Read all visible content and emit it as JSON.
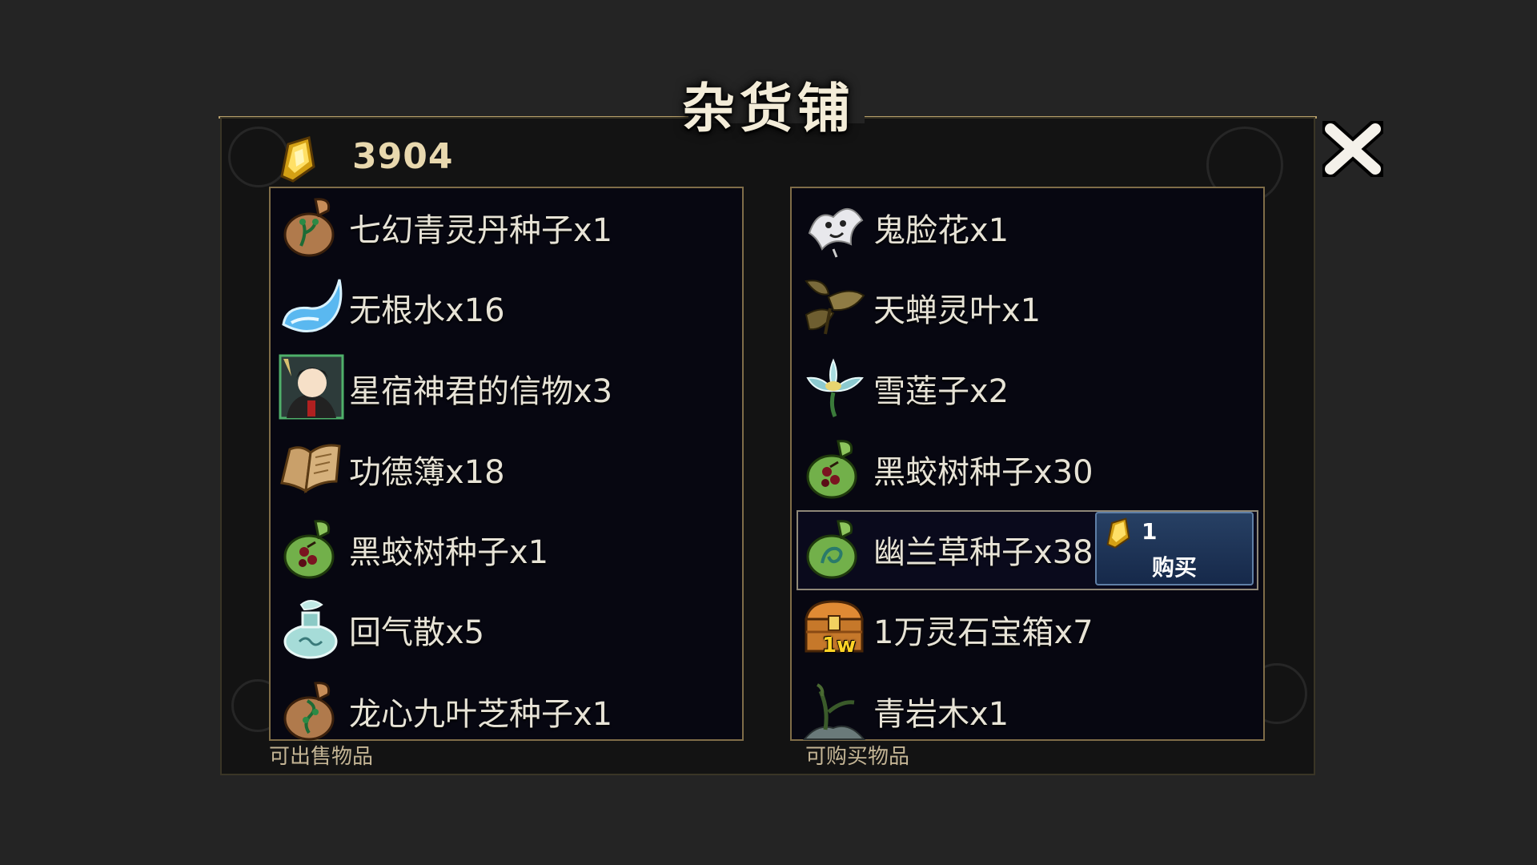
{
  "shop": {
    "title": "杂货铺",
    "currency": {
      "icon": "spirit-stone-icon",
      "amount": "3904"
    },
    "close_icon": "close-icon"
  },
  "sell_list": {
    "caption": "可出售物品",
    "items": [
      {
        "name": "七幻青灵丹种子x1",
        "icon": "brown-seed-bag-icon"
      },
      {
        "name": "无根水x16",
        "icon": "water-wisp-icon"
      },
      {
        "name": "星宿神君的信物x3",
        "icon": "deity-portrait-icon"
      },
      {
        "name": "功德簿x18",
        "icon": "open-book-icon"
      },
      {
        "name": "黑蛟树种子x1",
        "icon": "green-seed-bag-icon"
      },
      {
        "name": "回气散x5",
        "icon": "potion-jar-icon"
      },
      {
        "name": "龙心九叶芝种子x1",
        "icon": "brown-seed-bag-icon"
      }
    ]
  },
  "buy_list": {
    "caption": "可购买物品",
    "items": [
      {
        "name": "鬼脸花x1",
        "icon": "ghost-flower-icon"
      },
      {
        "name": "天蝉灵叶x1",
        "icon": "cicada-leaf-icon"
      },
      {
        "name": "雪莲子x2",
        "icon": "snow-lotus-icon"
      },
      {
        "name": "黑蛟树种子x30",
        "icon": "green-seed-bag-icon"
      },
      {
        "name": "幽兰草种子x38",
        "icon": "green-seed-bag-icon",
        "selected": true
      },
      {
        "name": "1万灵石宝箱x7",
        "icon": "treasure-chest-icon",
        "badge": "1w"
      },
      {
        "name": "青岩木x1",
        "icon": "sapling-rock-icon"
      }
    ],
    "buy_button": {
      "price": "1",
      "label": "购买",
      "icon": "spirit-stone-icon"
    }
  },
  "colors": {
    "accent_gold": "#b59d6a",
    "list_bg": "#070711",
    "buy_button": "#1e3558"
  }
}
